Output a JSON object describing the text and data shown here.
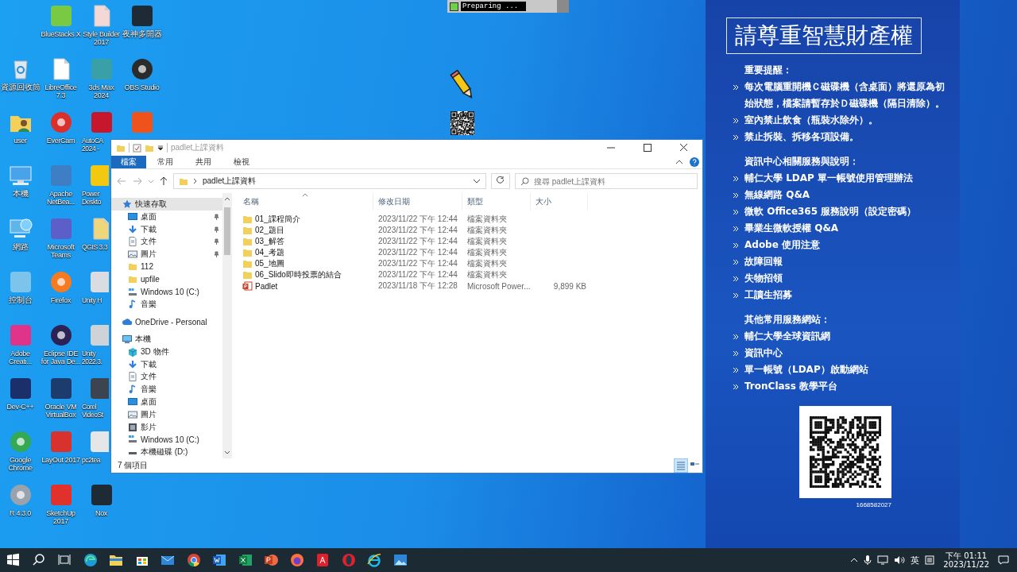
{
  "desktop": {
    "columns": [
      [
        {
          "label": "資源回收筒",
          "kind": "recycle",
          "color": "#dfe8f0"
        },
        {
          "label": "user",
          "kind": "folder",
          "color": "#f3cf5b"
        },
        {
          "label": "本機",
          "kind": "monitor",
          "color": "#4aa3e8"
        },
        {
          "label": "網路",
          "kind": "globe",
          "color": "#5fb4e8"
        },
        {
          "label": "控制台",
          "kind": "tile",
          "color": "#7cc4ec"
        },
        {
          "label": "Adobe\nCreati...",
          "kind": "tile",
          "color": "#e0338a"
        },
        {
          "label": "Dev-C++",
          "kind": "tile",
          "color": "#1b2f6b"
        },
        {
          "label": "Google\nChrome",
          "kind": "circle",
          "color": "#34a853"
        },
        {
          "label": "R 4.3.0",
          "kind": "circle",
          "color": "#9aa3ad"
        }
      ],
      [
        {
          "label": "BlueStacks X",
          "kind": "tile",
          "color": "#7ac943"
        },
        {
          "label": "LibreOffice\n7.3",
          "kind": "document",
          "color": "#ffffff"
        },
        {
          "label": "EverCam",
          "kind": "circle",
          "color": "#d9302c"
        },
        {
          "label": "Apache\nNetBea...",
          "kind": "tile",
          "color": "#3d7ec4"
        },
        {
          "label": "Microsoft\nTeams",
          "kind": "tile",
          "color": "#5b5fc7"
        },
        {
          "label": "Firefox",
          "kind": "circle",
          "color": "#f57a21"
        },
        {
          "label": "Eclipse IDE\nfor Java De...",
          "kind": "circle",
          "color": "#2c2255"
        },
        {
          "label": "Oracle VM\nVirtualBox",
          "kind": "tile",
          "color": "#1d3c6e"
        },
        {
          "label": "LayOut 2017",
          "kind": "tile",
          "color": "#d8322e"
        },
        {
          "label": "SketchUp\n2017",
          "kind": "tile",
          "color": "#e0312d"
        }
      ],
      [
        {
          "label": "Style Builder\n2017",
          "kind": "document",
          "color": "#f4d7d7"
        },
        {
          "label": "3ds Max\n2024",
          "kind": "tile",
          "color": "#3aa0a8"
        },
        {
          "label": "AutoCA\n2024 -",
          "kind": "tile",
          "color": "#c6172c"
        },
        {
          "label": "Power\nDeskto",
          "kind": "tile",
          "color": "#f2c811"
        },
        {
          "label": "QGIS 3.3",
          "kind": "document",
          "color": "#f0d67a"
        },
        {
          "label": "Unity H",
          "kind": "tile",
          "color": "#d9dde2"
        },
        {
          "label": "Unity\n2022.3.",
          "kind": "tile",
          "color": "#cfd3d8"
        },
        {
          "label": "Corel\nVideoSt",
          "kind": "tile",
          "color": "#3c4450"
        },
        {
          "label": "pc2tea",
          "kind": "tile",
          "color": "#e4e6e8"
        },
        {
          "label": "Nox",
          "kind": "tile",
          "color": "#1e2a36"
        }
      ],
      [
        {
          "label": "夜神多開器",
          "kind": "tile",
          "color": "#1e2a36"
        },
        {
          "label": "OBS Studio",
          "kind": "circle",
          "color": "#2b2b2b"
        },
        {
          "kind": "tile",
          "color": "#f0521c"
        }
      ]
    ]
  },
  "progress_window": {
    "text": "Preparing ..."
  },
  "explorer": {
    "title": "padlet上課資料",
    "tabs": [
      {
        "label": "檔案",
        "selected": true
      },
      {
        "label": "常用",
        "selected": false
      },
      {
        "label": "共用",
        "selected": false
      },
      {
        "label": "檢視",
        "selected": false
      }
    ],
    "address": "padlet上課資料",
    "search": {
      "placeholder": "搜尋 padlet上課資料"
    },
    "nav": [
      {
        "label": "快速存取",
        "kind": "star",
        "selected": true,
        "children": [
          {
            "label": "桌面",
            "kind": "desktop",
            "pinned": true
          },
          {
            "label": "下載",
            "kind": "download",
            "pinned": true
          },
          {
            "label": "文件",
            "kind": "document",
            "pinned": true
          },
          {
            "label": "圖片",
            "kind": "picture",
            "pinned": true
          },
          {
            "label": "112",
            "kind": "folder",
            "pinned": false
          },
          {
            "label": "upfile",
            "kind": "folder",
            "pinned": false
          },
          {
            "label": "Windows 10 (C:)",
            "kind": "drive",
            "pinned": false
          },
          {
            "label": "音樂",
            "kind": "music",
            "pinned": false
          }
        ]
      },
      {
        "label": "OneDrive - Personal",
        "kind": "cloud",
        "selected": false
      },
      {
        "label": "本機",
        "kind": "computer",
        "selected": false,
        "children": [
          {
            "label": "3D 物件",
            "kind": "cube"
          },
          {
            "label": "下載",
            "kind": "download"
          },
          {
            "label": "文件",
            "kind": "document"
          },
          {
            "label": "音樂",
            "kind": "music"
          },
          {
            "label": "桌面",
            "kind": "desktop"
          },
          {
            "label": "圖片",
            "kind": "picture"
          },
          {
            "label": "影片",
            "kind": "video"
          },
          {
            "label": "Windows 10 (C:)",
            "kind": "drive"
          },
          {
            "label": "本機磁碟 (D:)",
            "kind": "disk"
          }
        ]
      }
    ],
    "columns": [
      "名稱",
      "修改日期",
      "類型",
      "大小"
    ],
    "rows": [
      {
        "kind": "folder",
        "name": "01_課程簡介",
        "date": "2023/11/22 下午 12:44",
        "type": "檔案資料夾"
      },
      {
        "kind": "folder",
        "name": "02_題目",
        "date": "2023/11/22 下午 12:44",
        "type": "檔案資料夾"
      },
      {
        "kind": "folder",
        "name": "03_解答",
        "date": "2023/11/22 下午 12:44",
        "type": "檔案資料夾"
      },
      {
        "kind": "folder",
        "name": "04_考題",
        "date": "2023/11/22 下午 12:44",
        "type": "檔案資料夾"
      },
      {
        "kind": "folder",
        "name": "05_地圖",
        "date": "2023/11/22 下午 12:44",
        "type": "檔案資料夾"
      },
      {
        "kind": "folder",
        "name": "06_Slido即時投票的結合",
        "date": "2023/11/22 下午 12:44",
        "type": "檔案資料夾"
      },
      {
        "kind": "slides",
        "name": "Padlet",
        "date": "2023/11/18 下午 12:28",
        "type": "Microsoft Power...",
        "size": "9,899 KB"
      }
    ],
    "status": "7 個項目",
    "views": [
      {
        "kind": "details",
        "selected": true
      },
      {
        "kind": "thumbnails",
        "selected": false
      }
    ]
  },
  "notice": {
    "title": "請尊重智慧財產權",
    "sections": [
      {
        "heading": "重要提醒：",
        "items": [
          "每次電腦重開機Ｃ磁碟機（含桌面）將還原為初始狀態，檔案請暫存於Ｄ磁碟機（隔日清除）。",
          "室內禁止飲食（瓶裝水除外）。",
          "禁止拆裝、拆移各項設備。"
        ]
      },
      {
        "heading": "資訊中心相關服務與說明：",
        "items": [
          "輔仁大學 LDAP 單一帳號使用管理辦法",
          "無線網路 Q&A",
          "微軟 Office365 服務說明（設定密碼）",
          "畢業生微軟授權 Q&A",
          "Adobe 使用注意",
          "故障回報",
          "失物招領",
          "工讀生招募"
        ]
      },
      {
        "heading": "其他常用服務網站：",
        "items": [
          "輔仁大學全球資訊網",
          "資訊中心",
          "單一帳號（LDAP）啟動網站",
          "TronClass 教學平台"
        ]
      }
    ],
    "qr_caption": "1668582027"
  },
  "taskbar": {
    "apps": [
      {
        "kind": "start"
      },
      {
        "kind": "search"
      },
      {
        "kind": "taskview"
      },
      {
        "kind": "edge"
      },
      {
        "kind": "explorer"
      },
      {
        "kind": "store"
      },
      {
        "kind": "mail"
      },
      {
        "kind": "chrome"
      },
      {
        "kind": "word"
      },
      {
        "kind": "excel"
      },
      {
        "kind": "powerpoint"
      },
      {
        "kind": "firefox"
      },
      {
        "kind": "acrobat"
      },
      {
        "kind": "opera"
      },
      {
        "kind": "ie"
      },
      {
        "kind": "photos"
      }
    ],
    "ime": "英",
    "time": "下午 01:11",
    "date": "2023/11/22"
  }
}
